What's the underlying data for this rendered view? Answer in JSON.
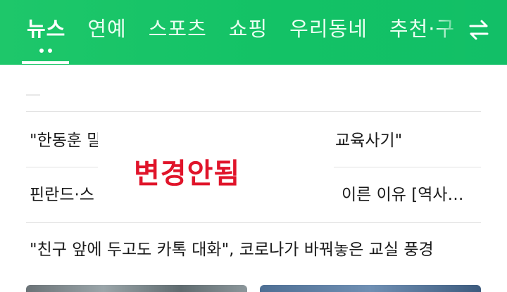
{
  "nav": {
    "tabs": [
      {
        "label": "뉴스",
        "active": true
      },
      {
        "label": "연예",
        "active": false
      },
      {
        "label": "스포츠",
        "active": false
      },
      {
        "label": "쇼핑",
        "active": false
      },
      {
        "label": "우리동네",
        "active": false
      },
      {
        "label": "추천·구",
        "active": false
      }
    ],
    "swap_icon": "swap-arrows-icon",
    "page_dots": 2
  },
  "colors": {
    "header_green": "#13c266",
    "stamp_red": "#e0142a"
  },
  "headlines": {
    "item1_left": "\"한동훈 말",
    "item1_right": "교육사기\"",
    "item2_left": "핀란드·스",
    "item2_right": "이른 이유 [역사…",
    "item3": "\"친구 앞에 두고도 카톡 대화\", 코로나가 바꿔놓은 교실 풍경"
  },
  "overlay": {
    "stamp_text": "변경안됨"
  }
}
